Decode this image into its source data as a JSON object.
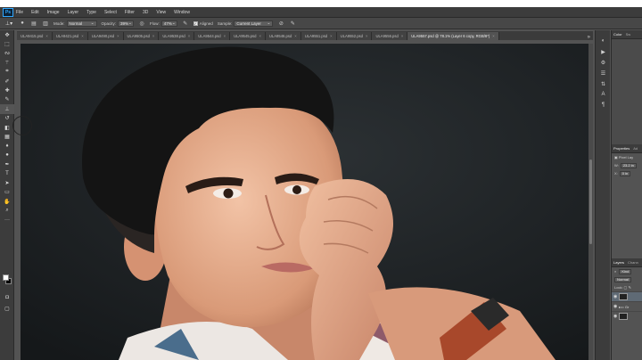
{
  "app": {
    "logo": "Ps"
  },
  "menu": [
    "File",
    "Edit",
    "Image",
    "Layer",
    "Type",
    "Select",
    "Filter",
    "3D",
    "View",
    "Window"
  ],
  "options": {
    "tool_icon": "clone-stamp-icon",
    "mode_label": "Mode:",
    "mode_value": "Normal",
    "opacity_label": "Opacity:",
    "opacity_value": "39%",
    "flow_label": "Flow:",
    "flow_value": "47%",
    "aligned_label": "Aligned",
    "sample_label": "Sample:",
    "sample_value": "Current Layer"
  },
  "tabs": [
    {
      "label": "ULA9415.psd",
      "active": false
    },
    {
      "label": "ULA9421.psd",
      "active": false
    },
    {
      "label": "ULA9490.psd",
      "active": false
    },
    {
      "label": "ULA9505.psd",
      "active": false
    },
    {
      "label": "ULA9538.psd",
      "active": false
    },
    {
      "label": "ULA9544.psd",
      "active": false
    },
    {
      "label": "ULA9545.psd",
      "active": false
    },
    {
      "label": "ULA9546.psd",
      "active": false
    },
    {
      "label": "ULA9551.psd",
      "active": false
    },
    {
      "label": "ULA9552.psd",
      "active": false
    },
    {
      "label": "ULA9556.psd",
      "active": false
    },
    {
      "label": "ULA9557.psd @ 78.1% (Layer 6 copy, RGB/8*)",
      "active": true
    }
  ],
  "tools": [
    "move-icon",
    "marquee-icon",
    "lasso-icon",
    "magic-wand-icon",
    "crop-icon",
    "eyedropper-icon",
    "healing-brush-icon",
    "brush-icon",
    "clone-stamp-icon",
    "history-brush-icon",
    "eraser-icon",
    "gradient-icon",
    "blur-icon",
    "dodge-icon",
    "pen-icon",
    "type-icon",
    "path-selection-icon",
    "rectangle-icon",
    "hand-icon",
    "zoom-icon",
    "more-tools-icon"
  ],
  "dock_icons": [
    "color-icon",
    "play-icon",
    "adjust-icon",
    "brush-settings-icon",
    "channels-icon",
    "text-icon",
    "paragraph-icon"
  ],
  "panels": {
    "top_tabs": [
      "Color",
      "Sw"
    ],
    "properties": {
      "tabs": [
        "Properties",
        "Ad"
      ],
      "layer_type": "Pixel Lay",
      "w_label": "W:",
      "w_value": "23.2 in",
      "x_label": "X:",
      "x_value": "0 in"
    },
    "layers": {
      "tabs": [
        "Layers",
        "Chann"
      ],
      "kind_label": "Kind",
      "blend_mode": "Normal",
      "lock_label": "Lock:",
      "row_label": "Gr"
    }
  }
}
